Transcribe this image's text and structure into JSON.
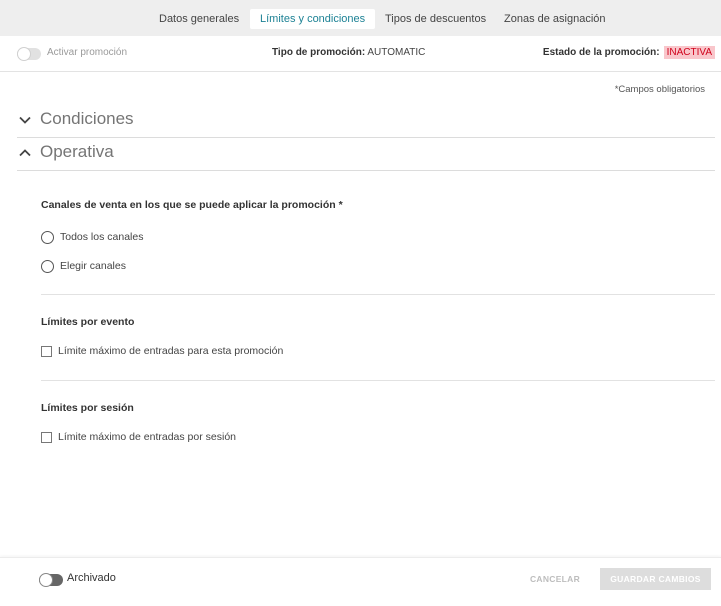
{
  "tabs": [
    {
      "label": "Datos generales",
      "active": false
    },
    {
      "label": "Límites y condiciones",
      "active": true
    },
    {
      "label": "Tipos de descuentos",
      "active": false
    },
    {
      "label": "Zonas de asignación",
      "active": false
    }
  ],
  "promo": {
    "toggle_label": "Activar promoción",
    "type_label": "Tipo de promoción:",
    "type_value": "AUTOMATIC",
    "status_label": "Estado de la promoción:",
    "status_value": "INACTIVA"
  },
  "required_note": "*Campos obligatorios",
  "sections": {
    "conditions": {
      "title": "Condiciones",
      "expanded": false
    },
    "operativa": {
      "title": "Operativa",
      "expanded": true
    }
  },
  "channels": {
    "title": "Canales de venta en los que se puede aplicar la promoción *",
    "options": [
      "Todos los canales",
      "Elegir canales"
    ]
  },
  "event_limits": {
    "title": "Límites por evento",
    "checkbox_label": "Límite máximo de entradas para esta promoción"
  },
  "session_limits": {
    "title": "Límites por sesión",
    "checkbox_label": "Límite máximo de entradas por sesión"
  },
  "footer": {
    "archived_label": "Archivado",
    "cancel_label": "CANCELAR",
    "save_label": "GUARDAR CAMBIOS"
  },
  "colors": {
    "accent": "#1d8295",
    "status_bg": "#f9c6cb",
    "status_text": "#d0021b"
  },
  "icons": {
    "conditions": "chevron-down-icon",
    "operativa": "chevron-up-icon"
  }
}
